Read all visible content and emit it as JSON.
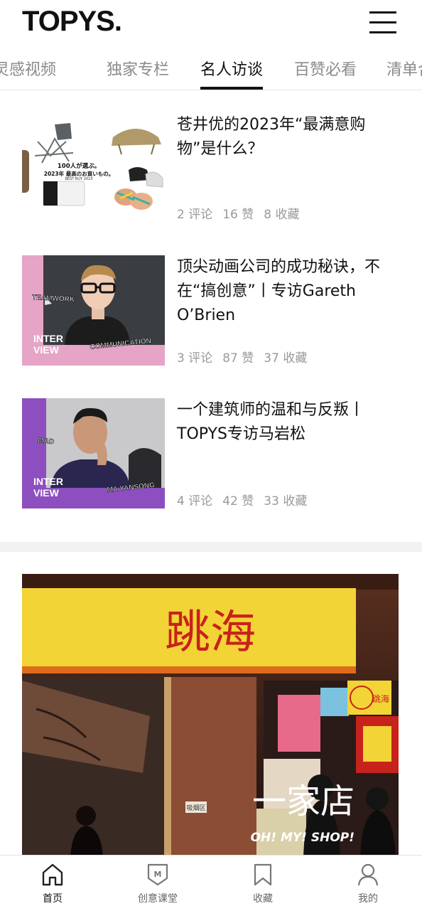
{
  "header": {
    "logo": "TOPYS."
  },
  "tabs": [
    {
      "label": "灵感视频",
      "active": false
    },
    {
      "label": "独家专栏",
      "active": false
    },
    {
      "label": "名人访谈",
      "active": true
    },
    {
      "label": "百赞必看",
      "active": false
    },
    {
      "label": "清单合集",
      "active": false
    }
  ],
  "articles": [
    {
      "title": "苍井优的2023年“最满意购物”是什么？",
      "comments": "2 评论",
      "likes": "16 赞",
      "saves": "8 收藏",
      "thumb_text": [
        "100人が選ぶ。",
        "2023年 最高のお買いもの。",
        "BEST BUY 2023"
      ]
    },
    {
      "title": "顶尖动画公司的成功秘诀，不在“搞创意”丨专访Gareth O’Brien",
      "comments": "3 评论",
      "likes": "87 赞",
      "saves": "37 收藏",
      "thumb_text": [
        "TEAMWORK",
        "COMMUNICATION",
        "INTER",
        "VIEW"
      ]
    },
    {
      "title": "一个建筑师的温和与反叛丨TOPYS专访马岩松",
      "comments": "4 评论",
      "likes": "42 赞",
      "saves": "33 收藏",
      "thumb_text": [
        "MAD",
        "MA YANSONG",
        "INTER",
        "VIEW"
      ]
    }
  ],
  "banner": {
    "sign": "跳海",
    "title": "一家店",
    "subtitle": "OH! MY! SHOP!",
    "small_signs": [
      "吸烟区",
      "跳海"
    ]
  },
  "bottom_nav": [
    {
      "label": "首页",
      "icon": "home-icon",
      "active": true
    },
    {
      "label": "创意课堂",
      "icon": "badge-m-icon",
      "active": false,
      "badge": "M"
    },
    {
      "label": "收藏",
      "icon": "bookmark-icon",
      "active": false
    },
    {
      "label": "我的",
      "icon": "profile-icon",
      "active": false
    }
  ],
  "colors": {
    "accent": "#111111",
    "muted": "#8a8a8a",
    "banner_yellow": "#f3d436",
    "sign_red": "#c7221b",
    "purple": "#8d4fc0",
    "pink": "#e6a4c7"
  }
}
